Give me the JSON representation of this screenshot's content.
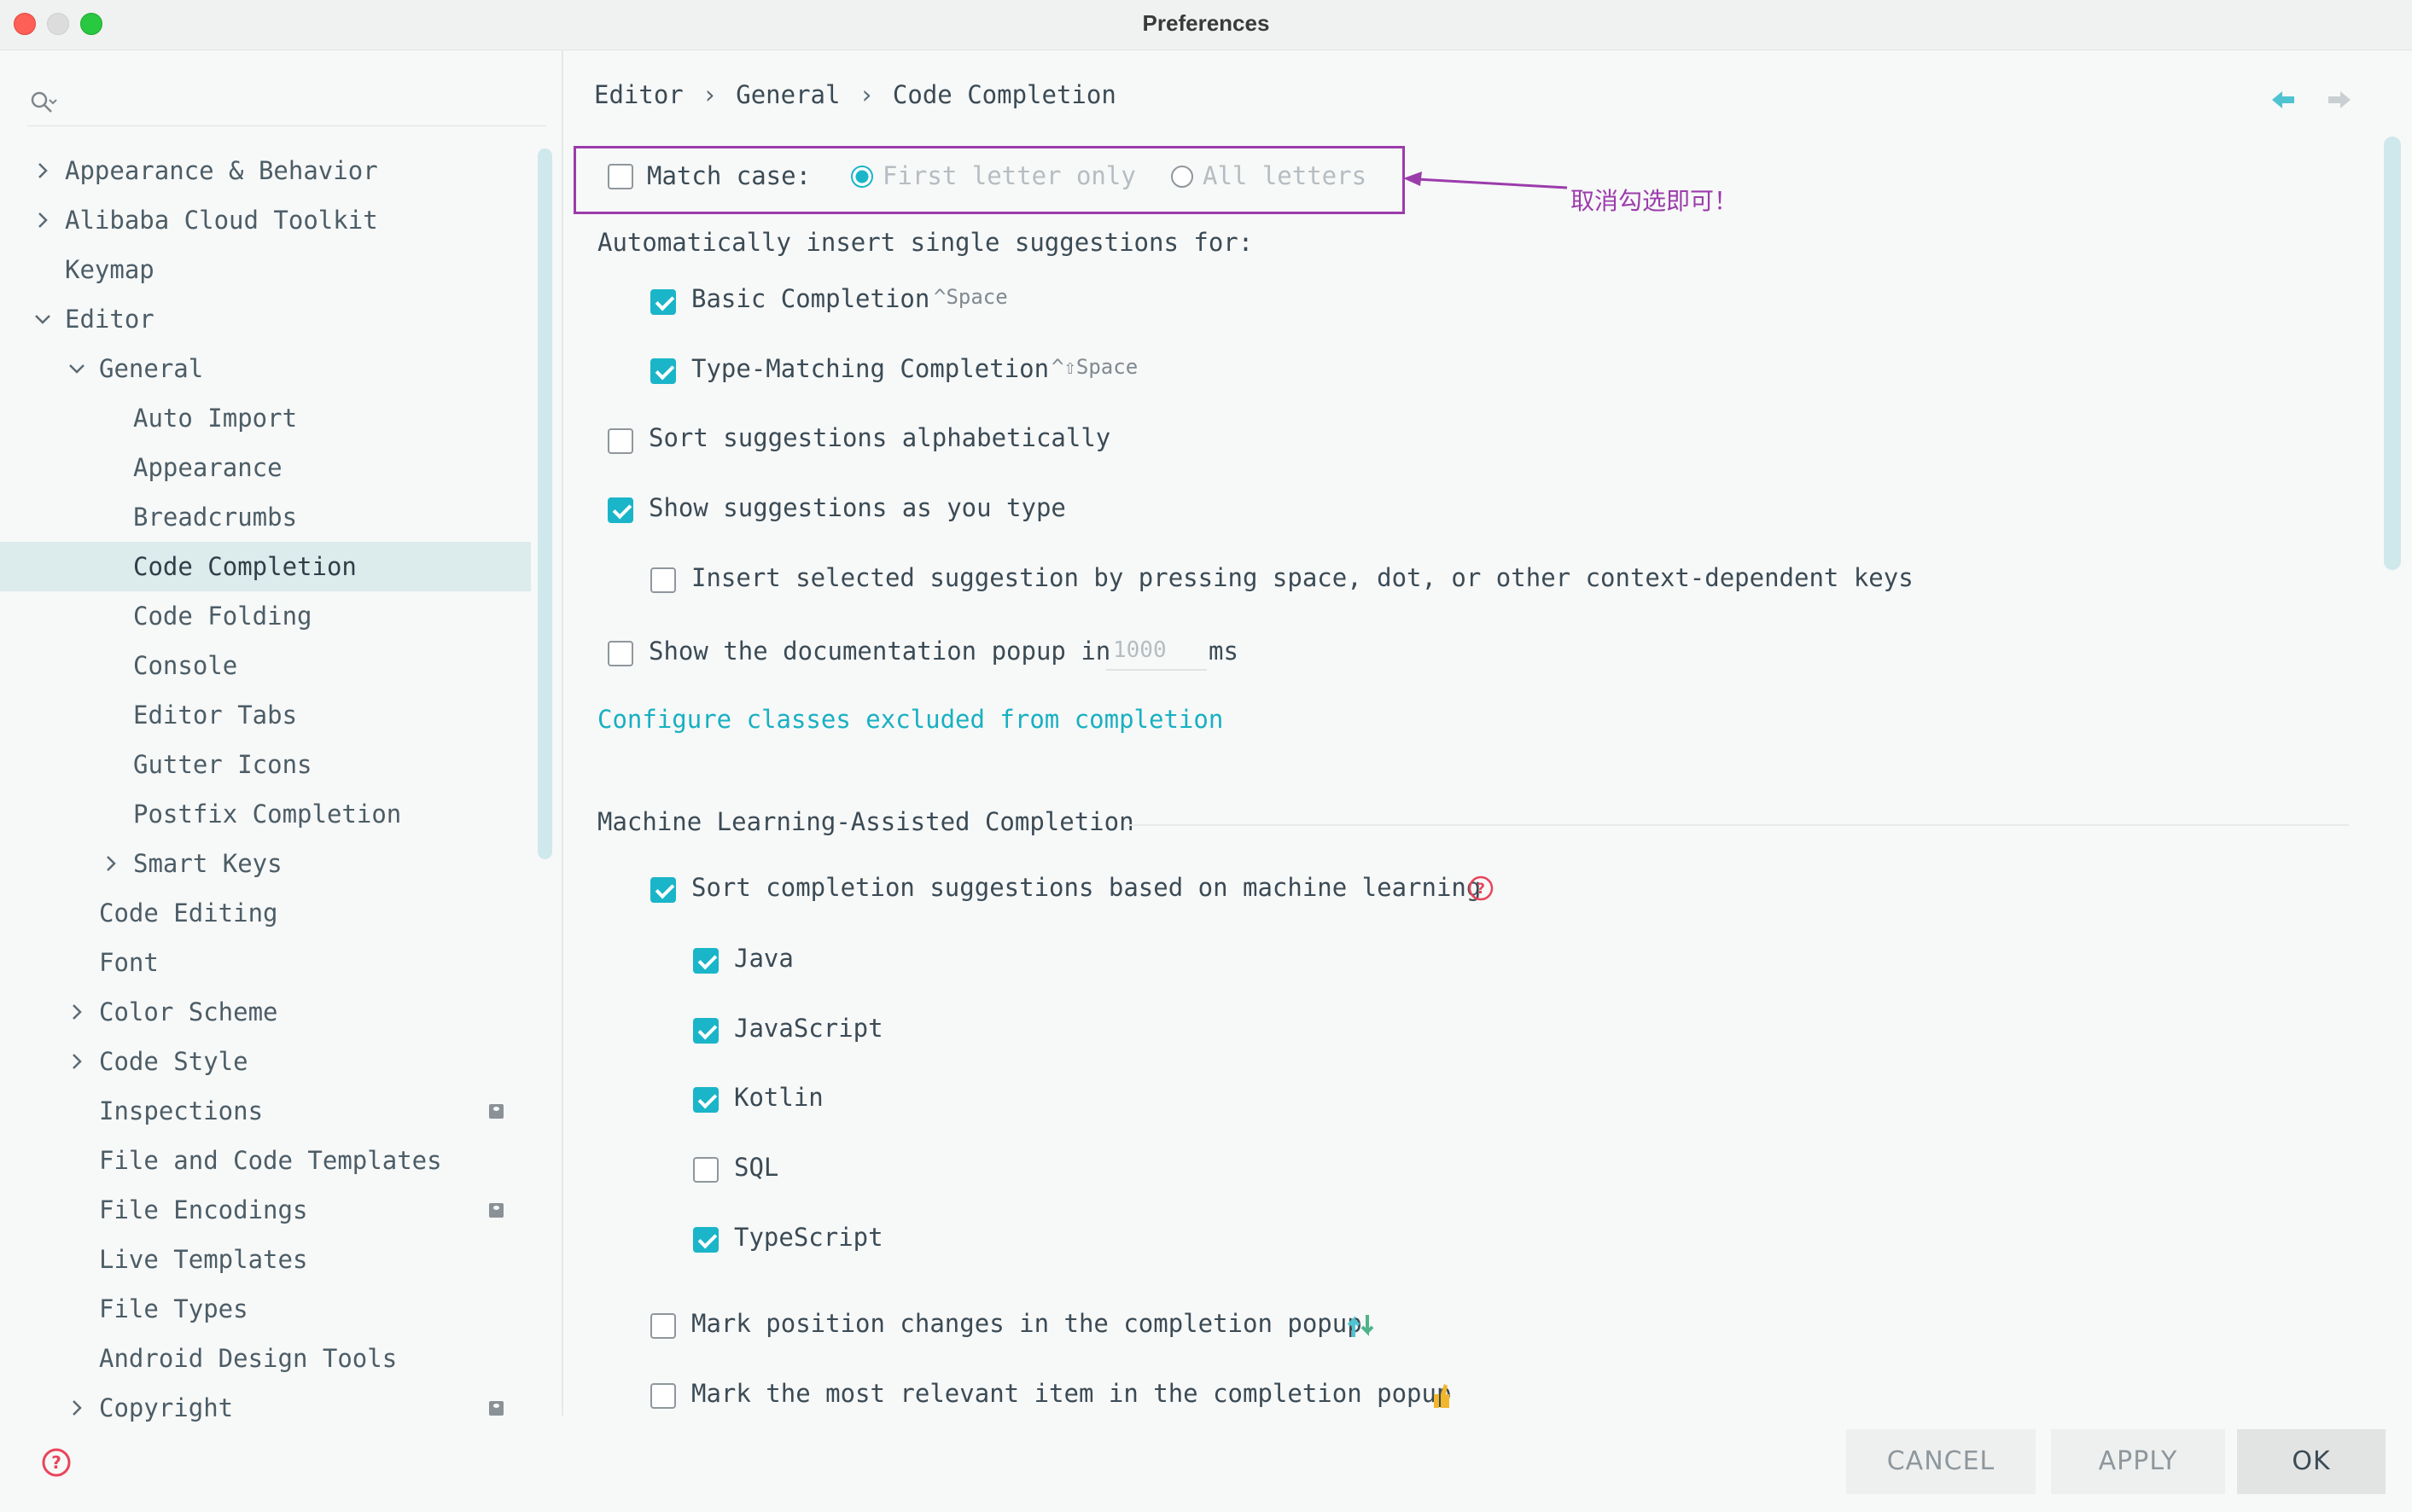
{
  "window": {
    "title": "Preferences"
  },
  "sidebar": {
    "items": [
      {
        "label": "Appearance & Behavior",
        "chevron": "right"
      },
      {
        "label": "Alibaba Cloud Toolkit",
        "chevron": "right"
      },
      {
        "label": "Keymap",
        "chevron": ""
      },
      {
        "label": "Editor",
        "chevron": "down"
      },
      {
        "label": "General",
        "chevron": "down"
      },
      {
        "label": "Auto Import",
        "chevron": ""
      },
      {
        "label": "Appearance",
        "chevron": ""
      },
      {
        "label": "Breadcrumbs",
        "chevron": ""
      },
      {
        "label": "Code Completion",
        "chevron": "",
        "selected": true
      },
      {
        "label": "Code Folding",
        "chevron": ""
      },
      {
        "label": "Console",
        "chevron": ""
      },
      {
        "label": "Editor Tabs",
        "chevron": ""
      },
      {
        "label": "Gutter Icons",
        "chevron": ""
      },
      {
        "label": "Postfix Completion",
        "chevron": ""
      },
      {
        "label": "Smart Keys",
        "chevron": "right"
      },
      {
        "label": "Code Editing",
        "chevron": ""
      },
      {
        "label": "Font",
        "chevron": ""
      },
      {
        "label": "Color Scheme",
        "chevron": "right"
      },
      {
        "label": "Code Style",
        "chevron": "right"
      },
      {
        "label": "Inspections",
        "chevron": "",
        "badge": true
      },
      {
        "label": "File and Code Templates",
        "chevron": ""
      },
      {
        "label": "File Encodings",
        "chevron": "",
        "badge": true
      },
      {
        "label": "Live Templates",
        "chevron": ""
      },
      {
        "label": "File Types",
        "chevron": ""
      },
      {
        "label": "Android Design Tools",
        "chevron": ""
      },
      {
        "label": "Copyright",
        "chevron": "right",
        "badge": true
      }
    ]
  },
  "breadcrumb": {
    "part1": "Editor",
    "part2": "General",
    "part3": "Code Completion",
    "separator": "›"
  },
  "match_case": {
    "label": "Match case:",
    "checked": false,
    "option_first": "First letter only",
    "option_all": "All letters",
    "selected": "First letter only"
  },
  "annotation": {
    "text": "取消勾选即可！",
    "color": "#9b3cab"
  },
  "auto_insert": {
    "label": "Automatically insert single suggestions for:",
    "basic": {
      "label": "Basic Completion",
      "shortcut": "^Space",
      "checked": true
    },
    "type_matching": {
      "label": "Type-Matching Completion",
      "shortcut": "^⇧Space",
      "checked": true
    }
  },
  "sort_alpha": {
    "label": "Sort suggestions alphabetically",
    "checked": false
  },
  "show_as_type": {
    "label": "Show suggestions as you type",
    "checked": true
  },
  "insert_selected": {
    "label": "Insert selected suggestion by pressing space, dot, or other context-dependent keys",
    "checked": false
  },
  "doc_popup": {
    "label": "Show the documentation popup in",
    "value": "1000",
    "unit": "ms",
    "checked": false
  },
  "configure_link": "Configure classes excluded from completion",
  "ml": {
    "section_title": "Machine Learning-Assisted Completion",
    "sort_ml": {
      "label": "Sort completion suggestions based on machine learning",
      "checked": true
    },
    "languages": [
      {
        "label": "Java",
        "checked": true
      },
      {
        "label": "JavaScript",
        "checked": true
      },
      {
        "label": "Kotlin",
        "checked": true
      },
      {
        "label": "SQL",
        "checked": false
      },
      {
        "label": "TypeScript",
        "checked": true
      }
    ],
    "mark_position": {
      "label": "Mark position changes in the completion popup",
      "checked": false
    },
    "mark_relevant": {
      "label": "Mark the most relevant item in the completion popup",
      "checked": false
    }
  },
  "buttons": {
    "cancel": "CANCEL",
    "apply": "APPLY",
    "ok": "OK"
  },
  "colors": {
    "accent": "#1ab5c8",
    "selection": "#dcebeb",
    "annotation": "#9b3cab",
    "help": "#e8455a"
  }
}
